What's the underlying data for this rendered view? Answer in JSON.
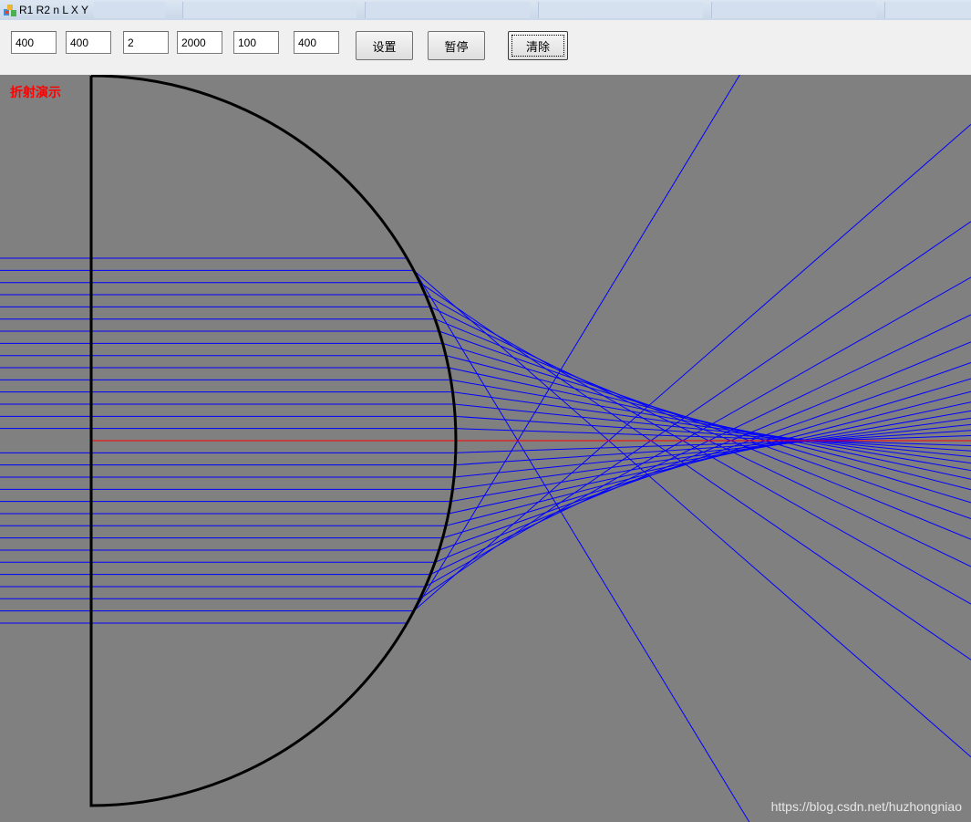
{
  "window": {
    "title": "R1 R2 n L X Y"
  },
  "toolbar": {
    "inputs": [
      {
        "name": "r1",
        "value": "400"
      },
      {
        "name": "r2",
        "value": "400"
      },
      {
        "name": "n",
        "value": "2"
      },
      {
        "name": "l",
        "value": "2000"
      },
      {
        "name": "x",
        "value": "100"
      },
      {
        "name": "y",
        "value": "400"
      }
    ],
    "set_label": "设置",
    "pause_label": "暂停",
    "clear_label": "清除"
  },
  "canvas": {
    "demo_title": "折射演示",
    "watermark": "https://blog.csdn.net/huzhongniao",
    "background_color": "#808080",
    "ray_color": "#0000ff",
    "axis_color": "#ff0000",
    "lens_color": "#000000",
    "title_color": "#ff0000"
  }
}
